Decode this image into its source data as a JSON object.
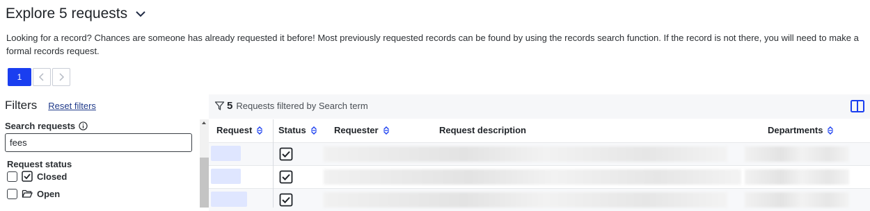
{
  "header": {
    "title": "Explore 5 requests",
    "toggle_icon": "chevron-down-icon"
  },
  "intro": "Looking for a record? Chances are someone has already requested it before! Most previously requested records can be found by using the records search function. If the record is not there, you will need to make a formal records request.",
  "pagination": {
    "current": "1",
    "prev_icon": "chevron-left-icon",
    "next_icon": "chevron-right-icon"
  },
  "filters": {
    "title": "Filters",
    "reset_label": "Reset filters",
    "search_label": "Search requests",
    "search_value": "fees",
    "status_label": "Request status",
    "options": [
      {
        "label": "Closed",
        "icon": "checked-box-icon",
        "checked": false
      },
      {
        "label": "Open",
        "icon": "folder-open-icon",
        "checked": false
      }
    ]
  },
  "results": {
    "count": "5",
    "filter_text": "Requests filtered by Search term",
    "filter_icon": "funnel-icon",
    "columns_icon": "columns-icon"
  },
  "table": {
    "columns": [
      "Request",
      "Status",
      "Requester",
      "Request description",
      "Departments"
    ],
    "visible_rows": 3,
    "status_icon": "checked-box-icon"
  },
  "colors": {
    "accent": "#1a3ef0",
    "link": "#1f3a8a",
    "toolbar_bg": "#f6f7f9"
  }
}
